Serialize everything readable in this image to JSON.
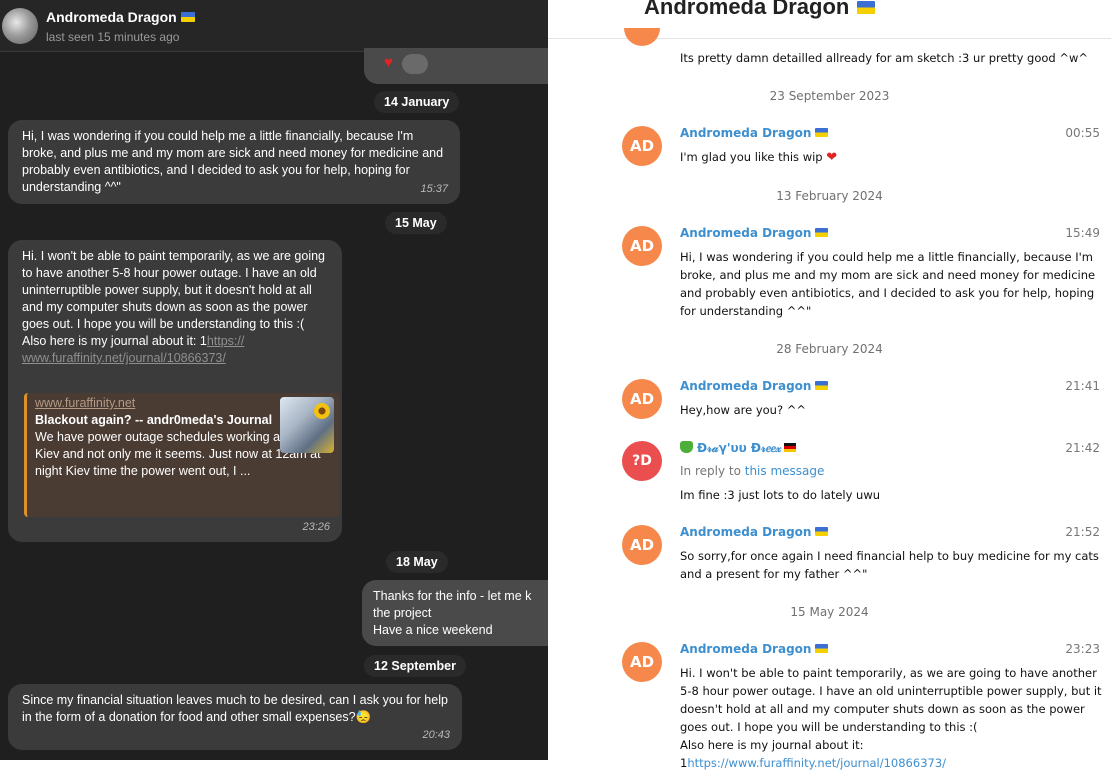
{
  "left": {
    "header": {
      "name": "Andromeda Dragon",
      "status": "last seen 15 minutes ago"
    },
    "dates": [
      "14 January",
      "15 May",
      "18 May",
      "12 September"
    ],
    "messages": [
      {
        "text": "Hi, I was wondering if you could help me a little financially, because I'm broke, and plus me and my mom are sick and need money for medicine and probably even antibiotics, and I decided to ask you for help, hoping for understanding ^^\"",
        "time": "15:37"
      },
      {
        "text": "Hi. I won't be able to paint temporarily, as we are going to have another 5-8 hour power outage. I have an old uninterruptible power supply, but it doesn't hold at all and my computer shuts down as soon as the power goes out. I hope you will be understanding to this :(",
        "text2": "Also here is my journal about it: 1",
        "link": "https://www.furaffinity.net/journal/10866373/",
        "link_part1": "https://",
        "link_part2": "www.furaffinity.net/journal/10866373/",
        "time": "23:26",
        "preview": {
          "site": "www.furaffinity.net",
          "title": "Blackout again? -- andr0meda's Journal",
          "desc": "We have power outage schedules working again in Kiev and not only me it seems. Just now at 12am at night Kiev time the power went out, I ..."
        }
      },
      {
        "line1": "Thanks for the info - let me k",
        "line2": "the project",
        "line3": "Have a nice weekend"
      },
      {
        "text": "Since my financial situation leaves much to be desired, can I ask you for help in the form of a donation for food and other small expenses?",
        "emoji": "😓",
        "time": "20:43"
      }
    ]
  },
  "right": {
    "header": {
      "title": "Andromeda Dragon"
    },
    "top_text": "Its pretty damn detailled allready for am sketch :3 ur pretty good ^w^",
    "separators": [
      "23 September 2023",
      "13 February 2024",
      "28 February 2024",
      "15 May 2024"
    ],
    "messages": [
      {
        "avatar": "AD",
        "name": "Andromeda Dragon",
        "time": "00:55",
        "text": "I'm glad you like this wip"
      },
      {
        "avatar": "AD",
        "name": "Andromeda Dragon",
        "time": "15:49",
        "text": "Hi, I was wondering if you could help me a little financially, because I'm broke, and plus me and my mom are sick and need money for medicine and probably even antibiotics, and I decided to ask you for help, hoping for understanding ^^\""
      },
      {
        "avatar": "AD",
        "name": "Andromeda Dragon",
        "time": "21:41",
        "text": "Hey,how are you? ^^"
      },
      {
        "avatar": "?D",
        "name": "Đ𝓇𝒶γ'υυ Đ𝓇𝑒𝑒𝓍",
        "time": "21:42",
        "reply_prefix": "In reply to ",
        "reply_link": "this message",
        "text": "Im fine :3 just lots to do lately uwu"
      },
      {
        "avatar": "AD",
        "name": "Andromeda Dragon",
        "time": "21:52",
        "text": "So sorry,for once again I need financial help to buy medicine for my cats and a present for my father ^^\""
      },
      {
        "avatar": "AD",
        "name": "Andromeda Dragon",
        "time": "23:23",
        "text": "Hi. I won't be able to paint temporarily, as we are going to have another 5-8 hour power outage. I have an old uninterruptible power supply, but it doesn't hold at all and my computer shuts down as soon as the power goes out. I hope you will be understanding to this :(",
        "text2": "Also here is my journal about it:",
        "link_prefix": "1",
        "link": "https://www.furaffinity.net/journal/10866373/"
      }
    ]
  },
  "colors": {
    "dark_bg": "#1f1f1f",
    "incoming_bubble": "#3b3b3b",
    "avatar_orange": "#f5884a",
    "avatar_red": "#ea4e4e",
    "name_blue": "#3d8fcf"
  }
}
